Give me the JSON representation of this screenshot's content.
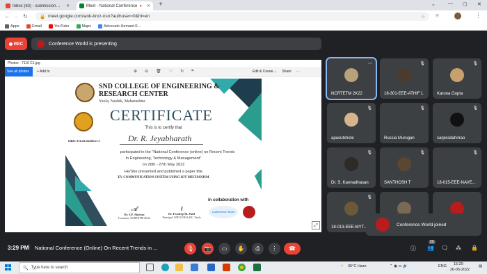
{
  "browser": {
    "tabs": [
      {
        "label": "Inbox (83) - submission@gsconf",
        "active": false,
        "favicon_color": "#ea4335"
      },
      {
        "label": "Meet - National Conference",
        "active": true,
        "favicon_color": "#00832d"
      }
    ],
    "new_tab": "+",
    "url": "meet.google.com/ank-brxz-nsn?authuser=0&hl=en",
    "window_controls": [
      "⌄",
      "—",
      "▢",
      "✕"
    ],
    "bookmarks": [
      {
        "label": "Apps",
        "color": "#5f6368"
      },
      {
        "label": "Gmail",
        "color": "#ea4335"
      },
      {
        "label": "YouTube",
        "color": "#ff0000"
      },
      {
        "label": "Maps",
        "color": "#34a853"
      },
      {
        "label": "Advocate Hemant K...",
        "color": "#4285f4"
      }
    ]
  },
  "meet": {
    "rec_label": "REC",
    "presenting_text": "Conference World is presenting",
    "photos_window": {
      "title": "Photos - 7110 C1.jpg",
      "see_all": "See all photos",
      "add_to": "+ Add to",
      "edit_create": "Edit & Create ⌄",
      "share": "Share",
      "more": "···"
    },
    "certificate": {
      "college": "SND COLLEGE OF ENGINEERING &",
      "college2": "RESEARCH CENTER",
      "location": "Yeola, Nashik, Maharashtra",
      "title": "CERTIFICATE",
      "certify_line": "This is to certify that",
      "recipient": "Dr. R. Jeyabharath",
      "participated": "participated in the \"National Conference (online) on Recent Trends",
      "participated2": "In Engineering, Technology & Management\"",
      "dates": "on 26th - 27th May 2022",
      "presented": "He/She presented and published a paper title",
      "paper": "EV COMMUNICATION SYSTEM USING IOT MECHANISM",
      "isbn": "ISBN: 978-93-91535-07-7",
      "collab": "in collaboration with",
      "sig1_name": "Dr. S.P. Ahirrao",
      "sig1_role": "Convener, NCRTETM 2K22",
      "sig2_name": "Dr. Pradeep M. Patil",
      "sig2_role": "Principal, SND COE & RC, Yeola",
      "partner1": "Conference World"
    },
    "participants": [
      {
        "name": "NCRTETM 2K22",
        "avatar": "#b9a27a",
        "mic": "⋯"
      },
      {
        "name": "18-301-EEE-ATHIF L",
        "avatar": "#4b3b2e",
        "mic": "🎙"
      },
      {
        "name": "Karuna Gupta",
        "avatar": "#c8a06e",
        "mic": "🎙"
      },
      {
        "name": "apasutkhote",
        "avatar": "#d8b48a",
        "mic": "🎙"
      },
      {
        "name": "Russia Murugan",
        "avatar": "#3c4043",
        "mic": "🎙"
      },
      {
        "name": "sarjeradahirrao",
        "avatar": "#111111",
        "mic": "🎙"
      },
      {
        "name": "Dr. S. Kannadhasan",
        "avatar": "#2e2a26",
        "mic": "🎙"
      },
      {
        "name": "SANTHOSH T",
        "avatar": "#5a4633",
        "mic": "🎙"
      },
      {
        "name": "18-015-EEE-NAVE...",
        "avatar": "#3c4043",
        "mic": "🎙"
      },
      {
        "name": "18-013-EEE-MYT...",
        "avatar": "#6b5a3a",
        "mic": "🎙"
      },
      {
        "name": "",
        "avatar": "#7a6a55",
        "mic": ""
      },
      {
        "name": "",
        "avatar": "#b91c1c",
        "mic": ""
      }
    ],
    "toast": "Conference World joined",
    "time": "3:29 PM",
    "meeting_title": "National Conference (Online) On Recent Trends in ...",
    "participant_count": "29"
  },
  "taskbar": {
    "search_placeholder": "Type here to search",
    "weather": "36°C  Haze",
    "lang": "ENG",
    "time": "15:29",
    "date": "26-05-2022"
  }
}
